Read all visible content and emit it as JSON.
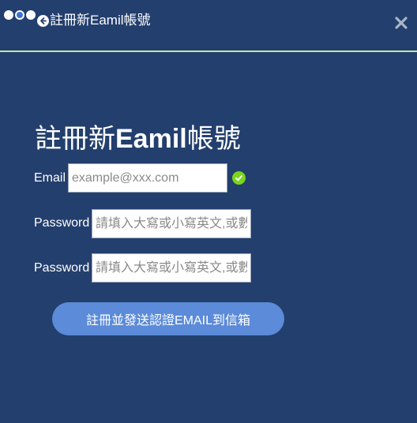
{
  "header": {
    "title": "註冊新Eamil帳號",
    "back_icon": "arrow-left-circle-icon",
    "close_icon": "close-icon",
    "accent_line_color": "#c9e79a"
  },
  "pager_dots": [
    {
      "active": false
    },
    {
      "active": true
    },
    {
      "active": false
    }
  ],
  "form": {
    "title_prefix": "註冊新",
    "title_bold": "Eamil",
    "title_suffix": "帳號",
    "email": {
      "label": "Email",
      "value": "",
      "placeholder": "example@xxx.com",
      "valid_icon": "check-circle-icon"
    },
    "password": {
      "label": "Password",
      "value": "",
      "placeholder": "請填入大寫或小寫英文,或數"
    },
    "password_confirm": {
      "label": "Password",
      "value": "",
      "placeholder": "請填入大寫或小寫英文,或數"
    },
    "submit_label": "註冊並發送認證EMAIL到信箱"
  },
  "colors": {
    "background": "#233f6e",
    "button": "#5b8bd9",
    "valid": "#7ad61a"
  }
}
